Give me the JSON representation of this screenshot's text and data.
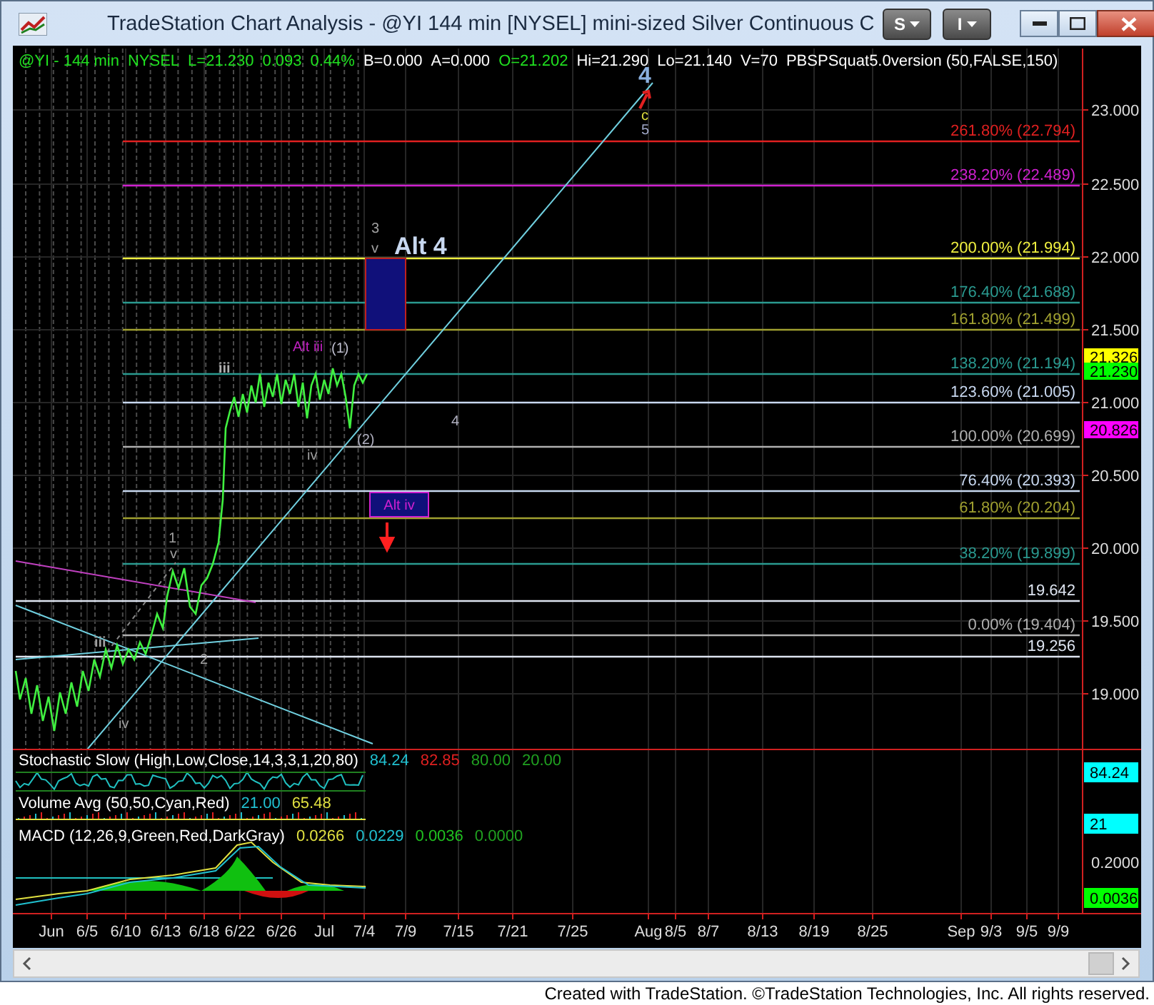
{
  "window": {
    "title": "TradeStation Chart Analysis - @YI 144 min [NYSEL] mini-sized Silver Continuous C",
    "menu_buttons": [
      "S",
      "I"
    ]
  },
  "chart": {
    "info_line": [
      {
        "text": "@YI - 144 min",
        "color": "#20e020"
      },
      {
        "text": "NYSEL",
        "color": "#20e020"
      },
      {
        "text": "L=21.230",
        "color": "#20e020"
      },
      {
        "text": "0.093",
        "color": "#20e020"
      },
      {
        "text": "0.44%",
        "color": "#20e020"
      },
      {
        "text": "B=0.000",
        "color": "#ffffff"
      },
      {
        "text": "A=0.000",
        "color": "#ffffff"
      },
      {
        "text": "O=21.202",
        "color": "#20e020"
      },
      {
        "text": "Hi=21.290",
        "color": "#ffffff"
      },
      {
        "text": "Lo=21.140",
        "color": "#ffffff"
      },
      {
        "text": "V=70",
        "color": "#ffffff"
      },
      {
        "text": "PBSPSquat5.0version (50,FALSE,150)",
        "color": "#ffffff"
      }
    ],
    "price_ticks": [
      "23.000",
      "22.500",
      "22.000",
      "21.500",
      "21.000",
      "20.500",
      "20.000",
      "19.500",
      "19.000"
    ],
    "price_markers": [
      {
        "text": "21.326",
        "color": "#ffff00"
      },
      {
        "text": "21.230",
        "color": "#00ff00"
      },
      {
        "text": "20.826",
        "color": "#ff00ff"
      }
    ],
    "fib_levels": [
      {
        "label": "261.80% (22.794)",
        "color": "#e02020"
      },
      {
        "label": "238.20% (22.489)",
        "color": "#d020d0"
      },
      {
        "label": "200.00% (21.994)",
        "color": "#f0f040"
      },
      {
        "label": "176.40% (21.688)",
        "color": "#2a9a90"
      },
      {
        "label": "161.80% (21.499)",
        "color": "#a0a030"
      },
      {
        "label": "138.20% (21.194)",
        "color": "#2a9a90"
      },
      {
        "label": "123.60% (21.005)",
        "color": "#c8d8f0"
      },
      {
        "label": "100.00% (20.699)",
        "color": "#b0b0b0"
      },
      {
        "label": "76.40% (20.393)",
        "color": "#c8d8f0"
      },
      {
        "label": "61.80% (20.204)",
        "color": "#a0a030"
      },
      {
        "label": "38.20% (19.899)",
        "color": "#2a9a90"
      },
      {
        "label": "19.642",
        "color": "#dde4f0"
      },
      {
        "label": "0.00% (19.404)",
        "color": "#b0b0b0"
      },
      {
        "label": "19.256",
        "color": "#dde4f0"
      }
    ],
    "annotations": [
      {
        "text": "4",
        "color": "#8ab0e0",
        "kind": "plain"
      },
      {
        "text": "c",
        "color": "#e0e040",
        "kind": "plain"
      },
      {
        "text": "5",
        "color": "#a0a8c8",
        "kind": "plain"
      },
      {
        "text": "3",
        "color": "#a0a0a0",
        "kind": "plain"
      },
      {
        "text": "v",
        "color": "#a0a0a0",
        "kind": "plain"
      },
      {
        "text": "Alt 4",
        "color": "#c8d8f0",
        "kind": "plain"
      },
      {
        "text": "Alt iii",
        "color": "#c020c0",
        "kind": "plain"
      },
      {
        "text": "(1)",
        "color": "#c0c0d0",
        "kind": "plain"
      },
      {
        "text": "iii",
        "color": "#b0b0b0",
        "kind": "plain"
      },
      {
        "text": "4",
        "color": "#b0b0c0",
        "kind": "plain"
      },
      {
        "text": "iv",
        "color": "#a0a0a0",
        "kind": "plain"
      },
      {
        "text": "(2)",
        "color": "#b0b0c0",
        "kind": "plain"
      },
      {
        "text": "Alt iv",
        "color": "#d020d0",
        "kind": "boxed"
      },
      {
        "text": "1",
        "color": "#a0a0a0",
        "kind": "plain"
      },
      {
        "text": "v",
        "color": "#a0a0a0",
        "kind": "plain"
      },
      {
        "text": "iii",
        "color": "#a0a0a0",
        "kind": "plain"
      },
      {
        "text": "2",
        "color": "#a0a0a0",
        "kind": "plain"
      },
      {
        "text": "iv",
        "color": "#a0a0a0",
        "kind": "plain"
      }
    ]
  },
  "studies": [
    {
      "name": "Stochastic Slow (High,Low,Close,14,3,3,1,20,80)",
      "values": [
        {
          "text": "84.24",
          "color": "#20c0d0"
        },
        {
          "text": "82.85",
          "color": "#e02020"
        },
        {
          "text": "80.00",
          "color": "#20a020"
        },
        {
          "text": "20.00",
          "color": "#20a020"
        }
      ],
      "axis_labels": [
        {
          "text": "84.24",
          "boxed": true,
          "color": "#00ffff"
        }
      ]
    },
    {
      "name": "Volume Avg (50,50,Cyan,Red)",
      "values": [
        {
          "text": "21.00",
          "color": "#20c0d0"
        },
        {
          "text": "65.48",
          "color": "#e0e040"
        }
      ],
      "axis_labels": [
        {
          "text": "21",
          "boxed": true,
          "color": "#00ffff"
        }
      ]
    },
    {
      "name": "MACD (12,26,9,Green,Red,DarkGray)",
      "values": [
        {
          "text": "0.0266",
          "color": "#e0e040"
        },
        {
          "text": "0.0229",
          "color": "#20c0d0"
        },
        {
          "text": "0.0036",
          "color": "#20c020"
        },
        {
          "text": "0.0000",
          "color": "#20a020"
        }
      ],
      "axis_labels": [
        {
          "text": "0.2000",
          "boxed": false,
          "color": "#dddddd"
        },
        {
          "text": "0.0036",
          "boxed": true,
          "color": "#00ff00"
        }
      ]
    }
  ],
  "time_axis": [
    "Jun",
    "6/5",
    "6/10",
    "6/13",
    "6/18",
    "6/22",
    "6/26",
    "Jul",
    "7/4",
    "7/9",
    "7/15",
    "7/21",
    "7/25",
    "Aug",
    "8/5",
    "8/7",
    "8/13",
    "8/19",
    "8/25",
    "Sep",
    "9/3",
    "9/5",
    "9/9"
  ],
  "footer": "Created with TradeStation. ©TradeStation Technologies, Inc. All rights reserved."
}
